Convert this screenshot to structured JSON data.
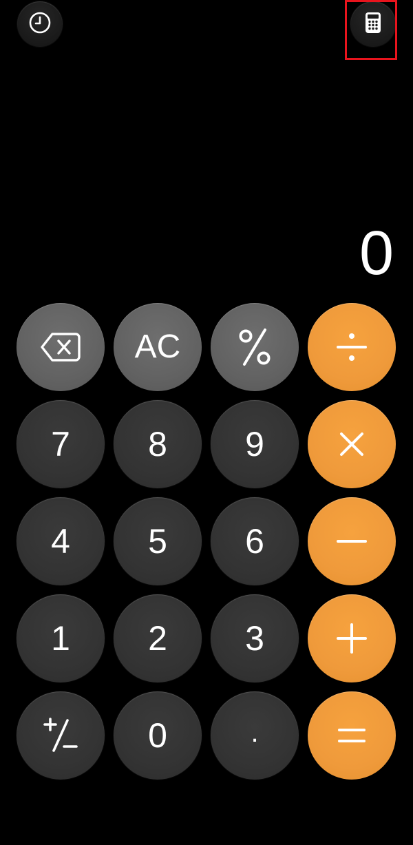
{
  "toolbar": {
    "history_icon": "clock-icon",
    "mode_icon": "calculator-icon"
  },
  "display": {
    "value": "0"
  },
  "keypad": {
    "rows": [
      [
        "backspace",
        "AC",
        "%",
        "÷"
      ],
      [
        "7",
        "8",
        "9",
        "×"
      ],
      [
        "4",
        "5",
        "6",
        "−"
      ],
      [
        "1",
        "2",
        "3",
        "+"
      ],
      [
        "+/−",
        "0",
        ".",
        "="
      ]
    ],
    "labels": {
      "ac": "AC",
      "seven": "7",
      "eight": "8",
      "nine": "9",
      "four": "4",
      "five": "5",
      "six": "6",
      "one": "1",
      "two": "2",
      "three": "3",
      "zero": "0",
      "decimal": "."
    }
  },
  "colors": {
    "background": "#000000",
    "number_key": "#333333",
    "function_key": "#626262",
    "operator_key": "#ef9a3b",
    "highlight": "#e8141d"
  }
}
